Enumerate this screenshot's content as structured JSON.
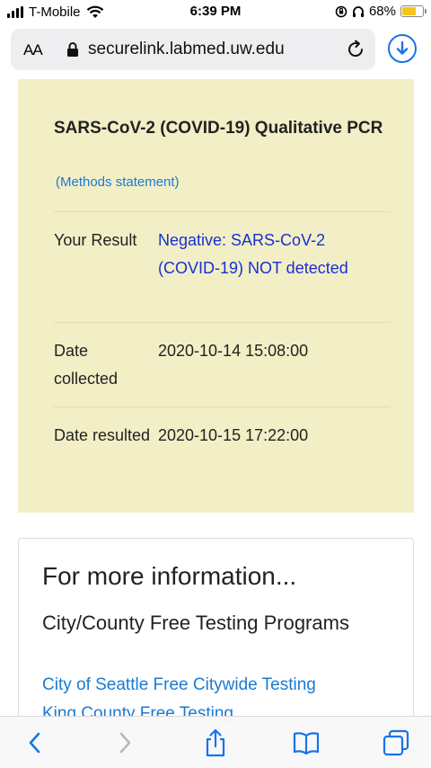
{
  "status_bar": {
    "carrier": "T-Mobile",
    "time": "6:39 PM",
    "battery": "68%",
    "battery_level": 0.68
  },
  "address_bar": {
    "text_size_button": "AA",
    "url": "securelink.labmed.uw.edu"
  },
  "result": {
    "test_name": "SARS-CoV-2 (COVID-19) Qualitative PCR",
    "methods_link": "(Methods statement)",
    "rows": [
      {
        "label": "Your Result",
        "value": "Negative: SARS-CoV-2 (COVID-19) NOT detected"
      },
      {
        "label": "Date collected",
        "value": "2020-10-14 15:08:00"
      },
      {
        "label": "Date resulted",
        "value": "2020-10-15 17:22:00"
      }
    ]
  },
  "info": {
    "heading": "For more information...",
    "subheading": "City/County Free Testing Programs",
    "links": [
      "City of Seattle Free Citywide Testing",
      "King County Free Testing"
    ]
  },
  "colors": {
    "card_background": "#f2efc6",
    "link_blue": "#1a7ad4",
    "result_link": "#1a2fd4",
    "safari_accent": "#1a73e8"
  },
  "toolbar_icons": [
    "back-icon",
    "forward-icon",
    "share-icon",
    "bookmarks-icon",
    "tabs-icon"
  ]
}
